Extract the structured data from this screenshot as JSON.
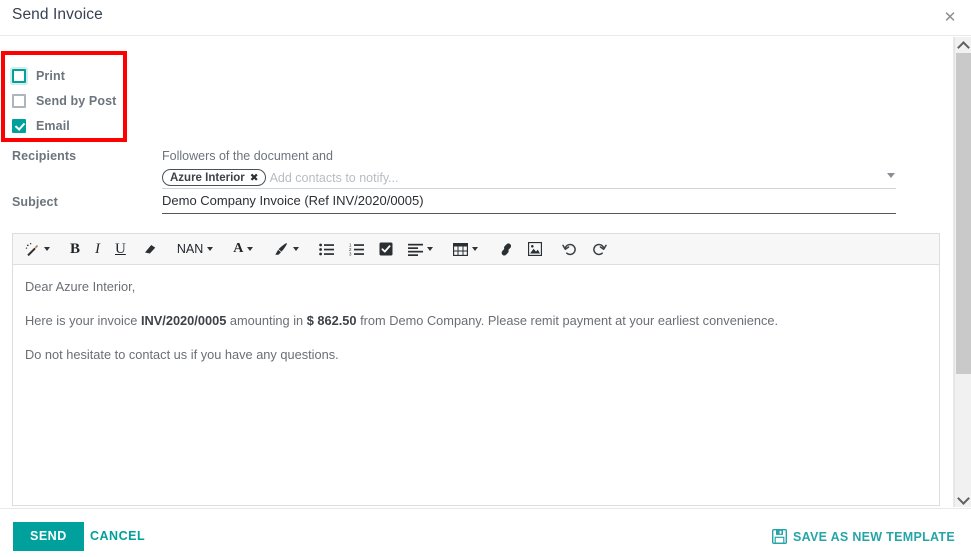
{
  "dialog": {
    "title": "Send Invoice",
    "close_icon": "close-icon"
  },
  "options": {
    "items": [
      {
        "label": "Print",
        "checked": false,
        "focused": true
      },
      {
        "label": "Send by Post",
        "checked": false,
        "focused": false
      },
      {
        "label": "Email",
        "checked": true,
        "focused": false
      }
    ]
  },
  "form": {
    "recipients_label": "Recipients",
    "followers_text": "Followers of the document and",
    "tags": [
      {
        "label": "Azure Interior",
        "remove_icon": "✖"
      }
    ],
    "recipients_placeholder": "Add contacts to notify...",
    "subject_label": "Subject",
    "subject_value": "Demo Company Invoice (Ref INV/2020/0005)"
  },
  "editor": {
    "toolbar": [
      {
        "name": "style-magic-wand",
        "type": "icon",
        "caret": true
      },
      {
        "name": "bold",
        "type": "text",
        "label": "B",
        "caret": false
      },
      {
        "name": "italic",
        "type": "text",
        "label": "I",
        "caret": false
      },
      {
        "name": "underline",
        "type": "text",
        "label": "U",
        "caret": false
      },
      {
        "name": "remove-format-eraser",
        "type": "icon",
        "caret": false
      },
      {
        "name": "font-size",
        "type": "text",
        "label": "NAN",
        "caret": true
      },
      {
        "name": "font-color",
        "type": "text",
        "label": "A",
        "caret": true
      },
      {
        "name": "background-color-brush",
        "type": "icon",
        "caret": true
      },
      {
        "name": "unordered-list",
        "type": "icon",
        "caret": false
      },
      {
        "name": "ordered-list",
        "type": "icon",
        "caret": false
      },
      {
        "name": "checklist",
        "type": "icon",
        "caret": false
      },
      {
        "name": "align",
        "type": "icon",
        "caret": true
      },
      {
        "name": "table",
        "type": "icon",
        "caret": true
      },
      {
        "name": "link",
        "type": "icon",
        "caret": false
      },
      {
        "name": "image",
        "type": "icon",
        "caret": false
      },
      {
        "name": "undo",
        "type": "icon",
        "caret": false
      },
      {
        "name": "redo",
        "type": "icon",
        "caret": false
      }
    ],
    "body": {
      "greeting": "Dear Azure Interior,",
      "paragraph_prefix": "Here is your invoice ",
      "invoice_ref": "INV/2020/0005",
      "paragraph_middle": " amounting in ",
      "amount": "$ 862.50",
      "paragraph_suffix": " from Demo Company. Please remit payment at your earliest convenience.",
      "closing": "Do not hesitate to contact us if you have any questions."
    }
  },
  "footer": {
    "send_label": "SEND",
    "cancel_label": "CANCEL",
    "save_template_label": "SAVE AS NEW TEMPLATE",
    "save_template_icon": "floppy-disk-icon"
  },
  "colors": {
    "accent_teal": "#00a09d",
    "template_teal": "#26a5a8",
    "highlight_red": "#ff0000",
    "label_gray": "#6c757d"
  }
}
